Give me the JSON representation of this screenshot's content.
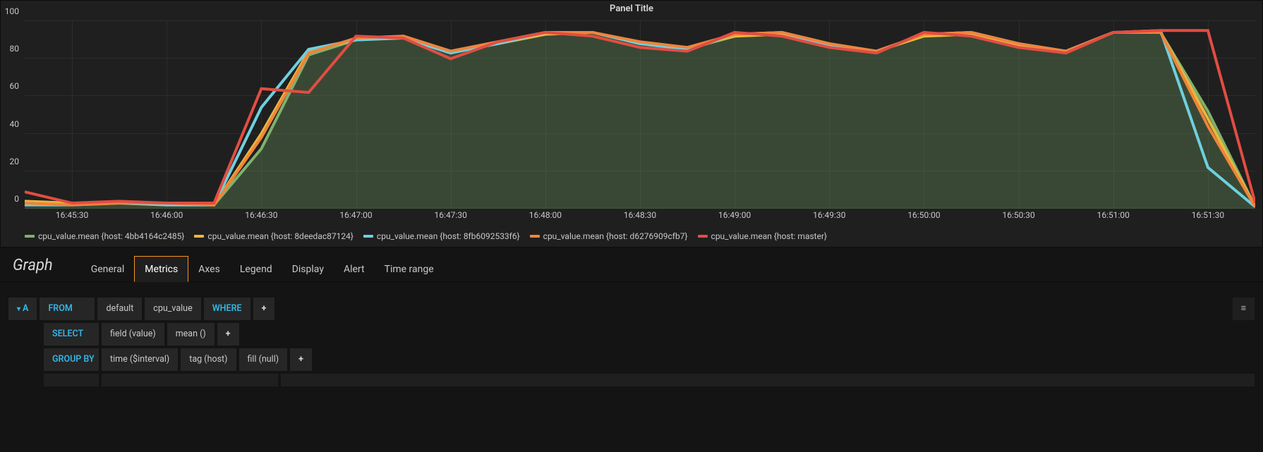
{
  "panel": {
    "title": "Panel Title"
  },
  "editor": {
    "title": "Graph",
    "tabs": [
      "General",
      "Metrics",
      "Axes",
      "Legend",
      "Display",
      "Alert",
      "Time range"
    ],
    "active_tab": "Metrics"
  },
  "query": {
    "toggle_label": "A",
    "from_kw": "FROM",
    "from_policy": "default",
    "from_measurement": "cpu_value",
    "where_kw": "WHERE",
    "select_kw": "SELECT",
    "select_field": "field (value)",
    "select_agg": "mean ()",
    "groupby_kw": "GROUP BY",
    "groupby_time": "time ($interval)",
    "groupby_tag": "tag (host)",
    "groupby_fill": "fill (null)",
    "plus": "+",
    "hamburger": "≡"
  },
  "chart_data": {
    "type": "line",
    "title": "Panel Title",
    "xlabel": "",
    "ylabel": "",
    "ylim": [
      0,
      100
    ],
    "y_ticks": [
      0,
      20,
      40,
      60,
      80,
      100
    ],
    "x_ticks": [
      "16:45:30",
      "16:46:00",
      "16:46:30",
      "16:47:00",
      "16:47:30",
      "16:48:00",
      "16:48:30",
      "16:49:00",
      "16:49:30",
      "16:50:00",
      "16:50:30",
      "16:51:00",
      "16:51:30"
    ],
    "categories": [
      "16:45:15",
      "16:45:30",
      "16:45:45",
      "16:46:00",
      "16:46:15",
      "16:46:30",
      "16:46:45",
      "16:47:00",
      "16:47:15",
      "16:47:30",
      "16:47:45",
      "16:48:00",
      "16:48:15",
      "16:48:30",
      "16:48:45",
      "16:49:00",
      "16:49:15",
      "16:49:30",
      "16:49:45",
      "16:50:00",
      "16:50:15",
      "16:50:30",
      "16:50:45",
      "16:51:00",
      "16:51:15",
      "16:51:30",
      "16:51:45"
    ],
    "series": [
      {
        "name": "cpu_value.mean {host: 4bb4164c2485}",
        "color": "#7eb26d",
        "values": [
          3,
          3,
          3,
          2,
          2,
          32,
          82,
          90,
          92,
          84,
          89,
          94,
          94,
          88,
          85,
          92,
          94,
          88,
          84,
          93,
          94,
          88,
          84,
          94,
          94,
          52,
          1
        ]
      },
      {
        "name": "cpu_value.mean {host: 8deedac87124}",
        "color": "#eab839",
        "values": [
          4,
          3,
          3,
          3,
          2,
          40,
          84,
          90,
          92,
          84,
          88,
          93,
          94,
          88,
          86,
          92,
          93,
          87,
          84,
          92,
          93,
          87,
          84,
          94,
          94,
          48,
          1
        ]
      },
      {
        "name": "cpu_value.mean {host: 8fb6092533f6}",
        "color": "#6ed0e0",
        "values": [
          2,
          2,
          3,
          2,
          2,
          54,
          85,
          90,
          91,
          83,
          88,
          94,
          94,
          88,
          85,
          93,
          94,
          87,
          84,
          93,
          94,
          88,
          84,
          94,
          95,
          22,
          1
        ]
      },
      {
        "name": "cpu_value.mean {host: d6276909cfb7}",
        "color": "#ef843c",
        "values": [
          3,
          2,
          3,
          3,
          2,
          38,
          83,
          91,
          92,
          84,
          89,
          94,
          94,
          89,
          86,
          93,
          94,
          88,
          84,
          93,
          94,
          88,
          84,
          94,
          94,
          44,
          1
        ]
      },
      {
        "name": "cpu_value.mean {host: master}",
        "color": "#e24d42",
        "values": [
          9,
          3,
          4,
          3,
          3,
          64,
          62,
          92,
          91,
          80,
          89,
          94,
          92,
          86,
          84,
          94,
          92,
          86,
          83,
          94,
          92,
          86,
          83,
          94,
          95,
          95,
          3
        ]
      }
    ],
    "legend_position": "bottom"
  }
}
